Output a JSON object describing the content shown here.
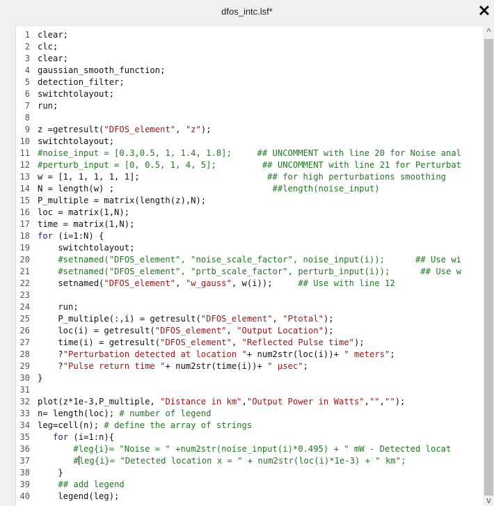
{
  "window": {
    "title": "dfos_intc.lsf*",
    "close_label": "✕"
  },
  "editor": {
    "lines": [
      [
        [
          "clear;",
          "plain"
        ]
      ],
      [
        [
          "clc;",
          "plain"
        ]
      ],
      [
        [
          "clear;",
          "plain"
        ]
      ],
      [
        [
          "gaussian_smooth_function;",
          "plain"
        ]
      ],
      [
        [
          "detection_filter;",
          "plain"
        ]
      ],
      [
        [
          "switchtolayout;",
          "plain"
        ]
      ],
      [
        [
          "run;",
          "plain"
        ]
      ],
      [],
      [
        [
          "z =getresult(",
          "plain"
        ],
        [
          "\"DFOS_element\"",
          "str"
        ],
        [
          ", ",
          "plain"
        ],
        [
          "\"z\"",
          "str"
        ],
        [
          ");",
          "plain"
        ]
      ],
      [
        [
          "switchtolayout;",
          "plain"
        ]
      ],
      [
        [
          "#noise_input = [0.3,0.5, 1, 1.4, 1.8];     ## UNCOMMENT with line 20 for Noise anal",
          "cm"
        ]
      ],
      [
        [
          "#perturb_input = [0, 0.5, 1, 4, 5];         ## UNCOMMENT with line 21 for Perturbat",
          "cm"
        ]
      ],
      [
        [
          "w = [1, 1, 1, 1, 1];",
          "plain"
        ],
        [
          "                         ## for high perturbations smoothing",
          "cm"
        ]
      ],
      [
        [
          "N = length(w) ;",
          "plain"
        ],
        [
          "                               ##length(noise_input)",
          "cm"
        ]
      ],
      [
        [
          "P_multiple = matrix(length(z),N);",
          "plain"
        ]
      ],
      [
        [
          "loc = matrix(1,N);",
          "plain"
        ]
      ],
      [
        [
          "time = matrix(1,N);",
          "plain"
        ]
      ],
      [
        [
          "for",
          "kw"
        ],
        [
          " (i=1:N) {",
          "plain"
        ]
      ],
      [
        [
          "    switchtolayout;",
          "plain"
        ]
      ],
      [
        [
          "    #setnamed(\"DFOS_element\", \"noise_scale_factor\", noise_input(i));      ## Use wi",
          "cm"
        ]
      ],
      [
        [
          "    #setnamed(\"DFOS_element\", \"prtb_scale_factor\", perturb_input(i));      ## Use w",
          "cm"
        ]
      ],
      [
        [
          "    setnamed(",
          "plain"
        ],
        [
          "\"DFOS_element\"",
          "str"
        ],
        [
          ", ",
          "plain"
        ],
        [
          "\"w_gauss\"",
          "str"
        ],
        [
          ", w(i));     ",
          "plain"
        ],
        [
          "## Use with line 12",
          "cm"
        ]
      ],
      [],
      [
        [
          "    run;",
          "plain"
        ]
      ],
      [
        [
          "    P_multiple(:,i) = getresult(",
          "plain"
        ],
        [
          "\"DFOS_element\"",
          "str"
        ],
        [
          ", ",
          "plain"
        ],
        [
          "\"Ptotal\"",
          "str"
        ],
        [
          ");",
          "plain"
        ]
      ],
      [
        [
          "    loc(i) = getresult(",
          "plain"
        ],
        [
          "\"DFOS_element\"",
          "str"
        ],
        [
          ", ",
          "plain"
        ],
        [
          "\"Output Location\"",
          "str"
        ],
        [
          ");",
          "plain"
        ]
      ],
      [
        [
          "    time(i) = getresult(",
          "plain"
        ],
        [
          "\"DFOS_element\"",
          "str"
        ],
        [
          ", ",
          "plain"
        ],
        [
          "\"Reflected Pulse time\"",
          "str"
        ],
        [
          ");",
          "plain"
        ]
      ],
      [
        [
          "    ?",
          "plain"
        ],
        [
          "\"Perturbation detected at location \"",
          "str"
        ],
        [
          "+ num2str(loc(i))+ ",
          "plain"
        ],
        [
          "\" meters\"",
          "str"
        ],
        [
          ";",
          "plain"
        ]
      ],
      [
        [
          "    ?",
          "plain"
        ],
        [
          "\"Pulse return time \"",
          "str"
        ],
        [
          "+ num2str(time(i))+ ",
          "plain"
        ],
        [
          "\" µsec\"",
          "str"
        ],
        [
          ";",
          "plain"
        ]
      ],
      [
        [
          "}",
          "plain"
        ]
      ],
      [],
      [
        [
          "plot(z*1e-3,P_multiple, ",
          "plain"
        ],
        [
          "\"Distance in km\"",
          "str"
        ],
        [
          ",",
          "plain"
        ],
        [
          "\"Output Power in Watts\"",
          "str"
        ],
        [
          ",",
          "plain"
        ],
        [
          "\"\"",
          "str"
        ],
        [
          ",",
          "plain"
        ],
        [
          "\"\"",
          "str"
        ],
        [
          ");",
          "plain"
        ]
      ],
      [
        [
          "n= length(loc); ",
          "plain"
        ],
        [
          "# number of legend",
          "cm"
        ]
      ],
      [
        [
          "leg=cell(n); ",
          "plain"
        ],
        [
          "# define the array of strings",
          "cm"
        ]
      ],
      [
        [
          "   ",
          "plain"
        ],
        [
          "for",
          "kw"
        ],
        [
          " (i=1:n){",
          "plain"
        ]
      ],
      [
        [
          "       #leg{i}= \"Noise = \" +num2str(noise_input(i)*0.495) + \" mW - Detected locat",
          "cm"
        ]
      ],
      [
        [
          "       #",
          "cm"
        ],
        [
          "",
          "cursor"
        ],
        [
          "leg{i}= \"Detected location x = \" + num2str(loc(i)*1e-3) + \" km\";",
          "cm"
        ]
      ],
      [
        [
          "    }",
          "plain"
        ]
      ],
      [
        [
          "    ",
          "plain"
        ],
        [
          "## add legend",
          "cm"
        ]
      ],
      [
        [
          "    legend(leg);",
          "plain"
        ]
      ]
    ]
  },
  "scrollbar": {
    "up_arrow": "^",
    "down_arrow": "v"
  }
}
